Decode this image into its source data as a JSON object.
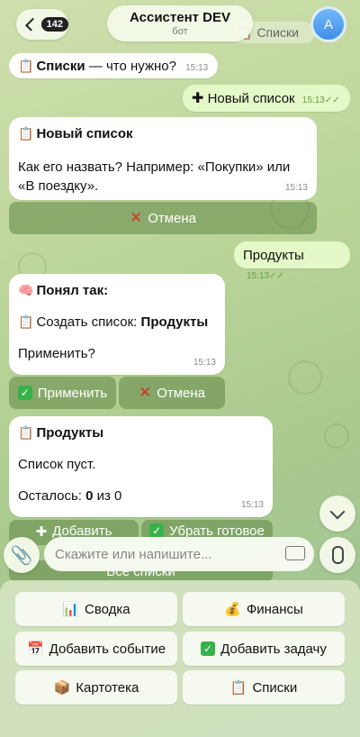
{
  "header": {
    "back_badge": "142",
    "title": "Ассистент DEV",
    "subtitle": "бот",
    "avatar_letter": "A",
    "ghost_lists_label": "Списки"
  },
  "messages": {
    "m1": {
      "title": "Списки",
      "text": " — что нужно?",
      "time": "15:13"
    },
    "m2": {
      "text": "Новый список",
      "time": "15:13"
    },
    "m3": {
      "title": "Новый список",
      "text": "Как его назвать? Например: «Покупки» или «В поездку».",
      "time": "15:13"
    },
    "m3_cancel": "Отмена",
    "m4": {
      "text": "Продукты",
      "time": "15:13"
    },
    "m5": {
      "title": "Понял так:",
      "action_prefix": "Создать список: ",
      "action_value": "Продукты",
      "question": "Применить?",
      "time": "15:13"
    },
    "m5_apply": "Применить",
    "m5_cancel": "Отмена",
    "m6": {
      "title": "Продукты",
      "text": "Список пуст.",
      "remaining_label": "Осталось: ",
      "remaining_done": "0",
      "remaining_rest": " из 0",
      "time": "15:13"
    },
    "m6_add": "Добавить",
    "m6_remove_done": "Убрать готовое",
    "m6_all_lists": "Все списки"
  },
  "input": {
    "placeholder": "Скажите или напишите..."
  },
  "reply_keyboard": {
    "summary": "Сводка",
    "finance": "Финансы",
    "add_event": "Добавить событие",
    "add_task": "Добавить задачу",
    "card_index": "Картотека",
    "lists": "Списки"
  },
  "icons": {
    "clipboard": "clipboard-icon",
    "plus": "plus-icon",
    "cross": "cross-mark-icon",
    "brain": "brain-icon",
    "check": "check-box-icon",
    "chart": "bar-chart-icon",
    "money": "money-bag-icon",
    "calendar": "calendar-icon",
    "box": "box-icon"
  }
}
